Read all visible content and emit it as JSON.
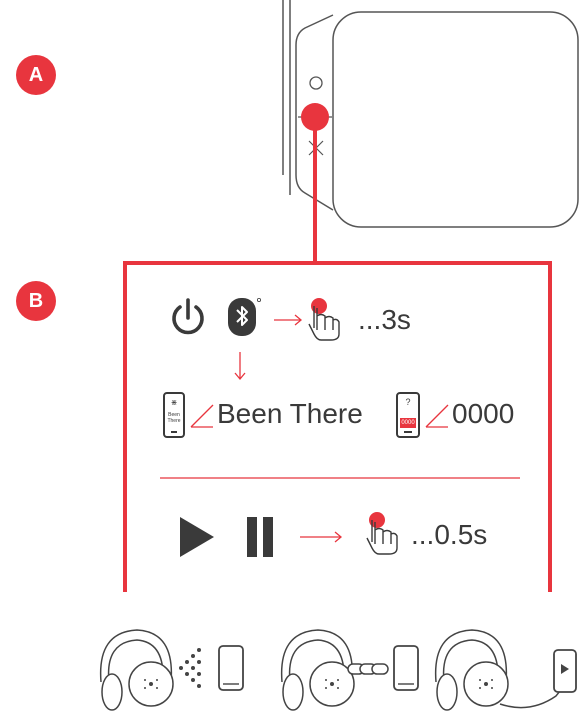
{
  "labels": {
    "section_a": "A",
    "section_b": "B"
  },
  "pairing": {
    "hold_time": "...3s",
    "device_name": "Been There",
    "pin_code": "0000",
    "phone_screen_name": "Been There",
    "pin_screen_question": "?",
    "pin_screen_code": "0000"
  },
  "playback": {
    "press_time": "...0.5s"
  },
  "icons": {
    "power": "power-icon",
    "bluetooth": "bluetooth-icon",
    "press": "finger-press-icon",
    "play": "play-icon",
    "pause": "pause-icon"
  },
  "colors": {
    "accent": "#e8353e",
    "line": "#444444",
    "text": "#3a3a3a"
  }
}
